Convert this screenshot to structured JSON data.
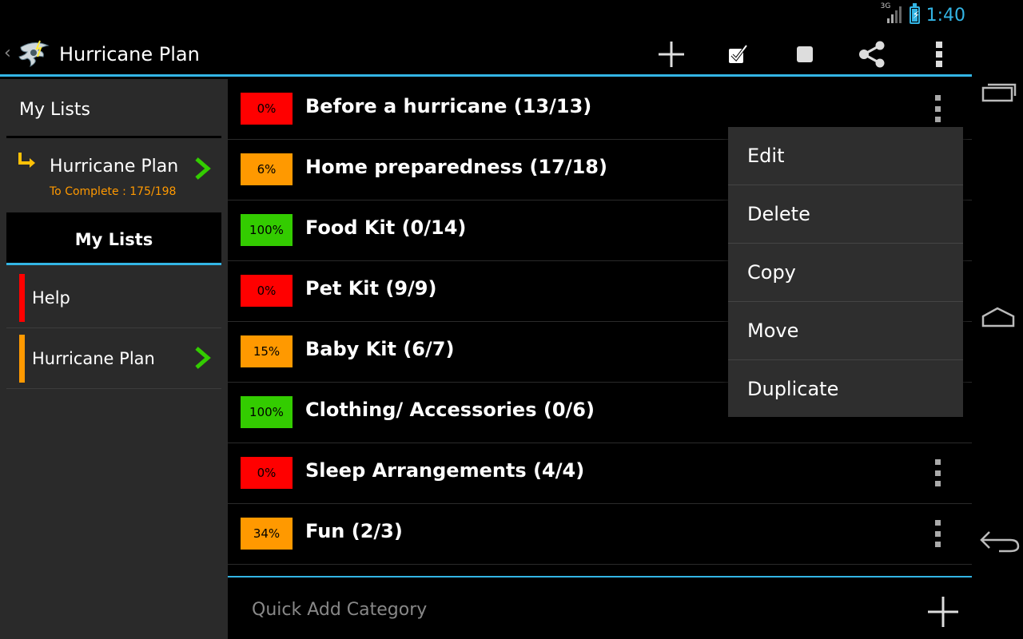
{
  "status_bar": {
    "network": "3G",
    "time": "1:40"
  },
  "action_bar": {
    "title": "Hurricane Plan",
    "icons": [
      "add-icon",
      "checked-box-icon",
      "unchecked-box-icon",
      "share-icon",
      "overflow-menu-icon"
    ]
  },
  "sidebar": {
    "header": "My Lists",
    "current": {
      "title": "Hurricane Plan",
      "subtitle": "To Complete : 175/198"
    },
    "section_title": "My Lists",
    "items": [
      {
        "label": "Help",
        "color": "#ff0000"
      },
      {
        "label": "Hurricane Plan",
        "color": "#ff9900"
      }
    ]
  },
  "rows": [
    {
      "pct": "0%",
      "pct_value": 0,
      "color": "#ff0000",
      "title": "Before a hurricane (13/13)"
    },
    {
      "pct": "6%",
      "pct_value": 6,
      "color": "#ff9900",
      "title": "Home preparedness (17/18)"
    },
    {
      "pct": "100%",
      "pct_value": 100,
      "color": "#33cc00",
      "title": "Food Kit (0/14)"
    },
    {
      "pct": "0%",
      "pct_value": 0,
      "color": "#ff0000",
      "title": "Pet Kit (9/9)"
    },
    {
      "pct": "15%",
      "pct_value": 15,
      "color": "#ff9900",
      "title": "Baby Kit (6/7)"
    },
    {
      "pct": "100%",
      "pct_value": 100,
      "color": "#33cc00",
      "title": "Clothing/ Accessories (0/6)"
    },
    {
      "pct": "0%",
      "pct_value": 0,
      "color": "#ff0000",
      "title": "Sleep Arrangements (4/4)"
    },
    {
      "pct": "34%",
      "pct_value": 34,
      "color": "#ff9900",
      "title": "Fun (2/3)"
    }
  ],
  "popup_menu": {
    "items": [
      "Edit",
      "Delete",
      "Copy",
      "Move",
      "Duplicate"
    ]
  },
  "quick_add": {
    "placeholder": "Quick Add Category"
  },
  "colors": {
    "accent": "#33b5e5",
    "sidebar_bg": "#2a2a2a",
    "chevron": "#33cc00"
  }
}
